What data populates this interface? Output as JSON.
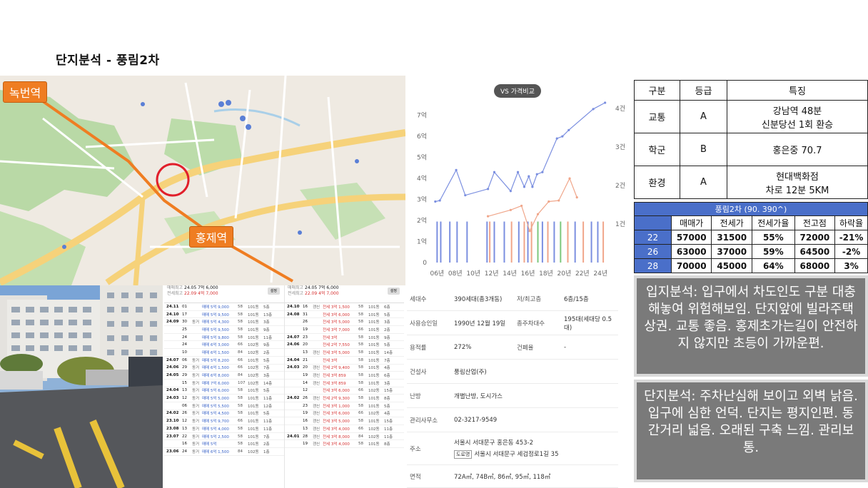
{
  "title": "단지분석 -  풍림2차",
  "map": {
    "station_1": "녹번역",
    "station_2": "홍제역"
  },
  "transactions": {
    "left": {
      "header_line1": "24.05  7억 6,000",
      "header_line2": "22.09  4억 7,000",
      "header_label1": "매매최고",
      "header_label2": "전세최고",
      "button": "설정",
      "rows": [
        {
          "date": "24.11",
          "day": "01",
          "type": "",
          "price": "매매 5억 9,000",
          "size": "58",
          "bldg": "101동",
          "floor": "5층"
        },
        {
          "date": "24.10",
          "day": "17",
          "type": "",
          "price": "매매 5억 9,500",
          "size": "58",
          "bldg": "101동",
          "floor": "13층"
        },
        {
          "date": "24.09",
          "day": "30",
          "type": "동거",
          "price": "매매 5억 4,300",
          "size": "58",
          "bldg": "101동",
          "floor": "3층"
        },
        {
          "date": "",
          "day": "25",
          "type": "",
          "price": "매매 5억 9,500",
          "size": "58",
          "bldg": "101동",
          "floor": "9층"
        },
        {
          "date": "",
          "day": "24",
          "type": "",
          "price": "매매 5억 9,800",
          "size": "58",
          "bldg": "101동",
          "floor": "11층"
        },
        {
          "date": "",
          "day": "24",
          "type": "",
          "price": "매매 6억 3,000",
          "size": "66",
          "bldg": "102동",
          "floor": "9층"
        },
        {
          "date": "",
          "day": "10",
          "type": "",
          "price": "매매 6억 1,500",
          "size": "84",
          "bldg": "102동",
          "floor": "2층"
        },
        {
          "date": "24.07",
          "day": "06",
          "type": "동거",
          "price": "매매 5억 8,200",
          "size": "66",
          "bldg": "101동",
          "floor": "5층"
        },
        {
          "date": "24.06",
          "day": "29",
          "type": "동거",
          "price": "매매 6억 1,500",
          "size": "66",
          "bldg": "102동",
          "floor": "7층"
        },
        {
          "date": "24.05",
          "day": "29",
          "type": "동거",
          "price": "매매 6억 8,000",
          "size": "84",
          "bldg": "102동",
          "floor": "3층"
        },
        {
          "date": "",
          "day": "15",
          "type": "동거",
          "price": "매매 7억 6,000",
          "size": "107",
          "bldg": "102동",
          "floor": "14층"
        },
        {
          "date": "24.04",
          "day": "13",
          "type": "동거",
          "price": "매매 5억 6,000",
          "size": "58",
          "bldg": "101동",
          "floor": "5층"
        },
        {
          "date": "24.03",
          "day": "12",
          "type": "동거",
          "price": "매매 5억 5,000",
          "size": "58",
          "bldg": "101동",
          "floor": "11층"
        },
        {
          "date": "",
          "day": "06",
          "type": "동거",
          "price": "매매 5억 5,500",
          "size": "58",
          "bldg": "101동",
          "floor": "12층"
        },
        {
          "date": "24.02",
          "day": "26",
          "type": "동거",
          "price": "매매 5억 4,500",
          "size": "58",
          "bldg": "101동",
          "floor": "5층"
        },
        {
          "date": "23.10",
          "day": "12",
          "type": "동거",
          "price": "매매 5억 9,700",
          "size": "66",
          "bldg": "101동",
          "floor": "11층"
        },
        {
          "date": "23.08",
          "day": "13",
          "type": "동거",
          "price": "매매 5억 4,000",
          "size": "58",
          "bldg": "101동",
          "floor": "11층"
        },
        {
          "date": "23.07",
          "day": "22",
          "type": "동거",
          "price": "매매 5억 2,500",
          "size": "58",
          "bldg": "101동",
          "floor": "7층"
        },
        {
          "date": "",
          "day": "16",
          "type": "동거",
          "price": "매매 5억",
          "size": "58",
          "bldg": "101동",
          "floor": "2층"
        },
        {
          "date": "23.06",
          "day": "24",
          "type": "동거",
          "price": "매매 6억 1,500",
          "size": "84",
          "bldg": "102동",
          "floor": "1층"
        }
      ]
    },
    "right": {
      "header_line1": "24.05  7억 6,000",
      "header_line2": "22.09  4억 7,000",
      "header_label1": "매매최고",
      "header_label2": "전세최고",
      "button": "설정",
      "rows": [
        {
          "date": "24.10",
          "day": "16",
          "type": "갱신",
          "price": "전세 3억 1,500",
          "size": "58",
          "bldg": "101동",
          "floor": "6층"
        },
        {
          "date": "24.08",
          "day": "31",
          "type": "",
          "price": "전세 3억 6,000",
          "size": "58",
          "bldg": "101동",
          "floor": "5층"
        },
        {
          "date": "",
          "day": "26",
          "type": "",
          "price": "전세 3억 5,000",
          "size": "58",
          "bldg": "101동",
          "floor": "3층"
        },
        {
          "date": "",
          "day": "19",
          "type": "",
          "price": "전세 3억 7,000",
          "size": "66",
          "bldg": "101동",
          "floor": "2층"
        },
        {
          "date": "24.07",
          "day": "23",
          "type": "",
          "price": "전세 3억",
          "size": "58",
          "bldg": "101동",
          "floor": "9층"
        },
        {
          "date": "24.06",
          "day": "20",
          "type": "",
          "price": "전세 2억 7,550",
          "size": "58",
          "bldg": "101동",
          "floor": "5층"
        },
        {
          "date": "",
          "day": "13",
          "type": "갱신",
          "price": "전세 3억 5,000",
          "size": "58",
          "bldg": "101동",
          "floor": "14층"
        },
        {
          "date": "24.04",
          "day": "21",
          "type": "",
          "price": "전세 3억",
          "size": "58",
          "bldg": "101동",
          "floor": "7층"
        },
        {
          "date": "24.03",
          "day": "20",
          "type": "갱신",
          "price": "전세 2억 9,400",
          "size": "58",
          "bldg": "101동",
          "floor": "4층"
        },
        {
          "date": "",
          "day": "19",
          "type": "갱신",
          "price": "전세 3억 859",
          "size": "58",
          "bldg": "101동",
          "floor": "6층"
        },
        {
          "date": "",
          "day": "14",
          "type": "갱신",
          "price": "전세 3억 859",
          "size": "58",
          "bldg": "101동",
          "floor": "3층"
        },
        {
          "date": "",
          "day": "12",
          "type": "",
          "price": "전세 3억 6,000",
          "size": "66",
          "bldg": "102동",
          "floor": "15층"
        },
        {
          "date": "24.02",
          "day": "26",
          "type": "갱신",
          "price": "전세 2억 9,300",
          "size": "58",
          "bldg": "101동",
          "floor": "8층"
        },
        {
          "date": "",
          "day": "23",
          "type": "갱신",
          "price": "전세 3억 1,000",
          "size": "58",
          "bldg": "101동",
          "floor": "5층"
        },
        {
          "date": "",
          "day": "19",
          "type": "갱신",
          "price": "전세 3억 6,000",
          "size": "66",
          "bldg": "102동",
          "floor": "4층"
        },
        {
          "date": "",
          "day": "16",
          "type": "갱신",
          "price": "전세 3억 5,000",
          "size": "58",
          "bldg": "101동",
          "floor": "15층"
        },
        {
          "date": "",
          "day": "13",
          "type": "갱신",
          "price": "전세 3억 4,000",
          "size": "66",
          "bldg": "102동",
          "floor": "11층"
        },
        {
          "date": "24.01",
          "day": "28",
          "type": "갱신",
          "price": "전세 3억 8,000",
          "size": "84",
          "bldg": "102동",
          "floor": "11층"
        },
        {
          "date": "",
          "day": "19",
          "type": "갱신",
          "price": "전세 3억 4,000",
          "size": "58",
          "bldg": "101동",
          "floor": "8층"
        }
      ]
    }
  },
  "chart_data": {
    "type": "line",
    "title": "VS 가격비교",
    "y_left_ticks": [
      "0",
      "1억",
      "2억",
      "3억",
      "4억",
      "5억",
      "6억",
      "7억"
    ],
    "y_right_ticks": [
      "1건",
      "2건",
      "3건",
      "4건"
    ],
    "x_ticks": [
      "06년",
      "08년",
      "10년",
      "12년",
      "14년",
      "16년",
      "18년",
      "20년",
      "22년",
      "24년"
    ],
    "xlim": [
      2005.5,
      2025
    ],
    "ylim": [
      0,
      7.6
    ],
    "series": [
      {
        "color": "#7b8fe0",
        "points": [
          [
            2005.8,
            2.9
          ],
          [
            2006.3,
            2.95
          ],
          [
            2008.1,
            4.4
          ],
          [
            2009.1,
            3.2
          ],
          [
            2011.6,
            3.5
          ],
          [
            2012.3,
            4.3
          ],
          [
            2014.1,
            3.4
          ],
          [
            2014.9,
            4.3
          ],
          [
            2015.6,
            3.6
          ],
          [
            2016.1,
            4.1
          ],
          [
            2016.5,
            3.6
          ],
          [
            2017.0,
            4.2
          ],
          [
            2017.6,
            4.3
          ],
          [
            2019.2,
            5.9
          ],
          [
            2019.8,
            6.0
          ],
          [
            2020.5,
            6.3
          ],
          [
            2023.2,
            7.3
          ],
          [
            2024.5,
            7.6
          ]
        ],
        "unit": "억"
      },
      {
        "color": "#f0a68a",
        "points": [
          [
            2011.6,
            2.2
          ],
          [
            2014.1,
            2.5
          ],
          [
            2015.3,
            2.7
          ],
          [
            2016.2,
            1.5
          ],
          [
            2017.1,
            2.3
          ],
          [
            2018.3,
            2.9
          ],
          [
            2019.4,
            2.95
          ],
          [
            2020.6,
            4.0
          ],
          [
            2021.4,
            3.1
          ]
        ],
        "unit": "억"
      }
    ],
    "volume_bars": [
      {
        "x": 2006.0,
        "color": "#7b8fe0"
      },
      {
        "x": 2006.4,
        "color": "#7b8fe0"
      },
      {
        "x": 2007.4,
        "color": "#7b8fe0"
      },
      {
        "x": 2008.2,
        "color": "#7b8fe0"
      },
      {
        "x": 2009.3,
        "color": "#7b8fe0"
      },
      {
        "x": 2011.5,
        "color": "#7b8fe0"
      },
      {
        "x": 2011.8,
        "color": "#f0a68a"
      },
      {
        "x": 2012.3,
        "color": "#7b8fe0"
      },
      {
        "x": 2013.4,
        "color": "#7b8fe0"
      },
      {
        "x": 2014.2,
        "color": "#f0a68a"
      },
      {
        "x": 2015.0,
        "color": "#7b8fe0"
      },
      {
        "x": 2015.6,
        "color": "#f0a68a"
      },
      {
        "x": 2016.0,
        "color": "#7b8fe0"
      },
      {
        "x": 2016.4,
        "color": "#f0a68a"
      },
      {
        "x": 2017.1,
        "color": "#7dc87d"
      },
      {
        "x": 2017.6,
        "color": "#7b8fe0"
      },
      {
        "x": 2018.2,
        "color": "#f0a68a"
      },
      {
        "x": 2018.9,
        "color": "#7b8fe0"
      },
      {
        "x": 2019.6,
        "color": "#7dc87d"
      },
      {
        "x": 2020.4,
        "color": "#f0a68a"
      },
      {
        "x": 2021.2,
        "color": "#7b8fe0"
      },
      {
        "x": 2022.1,
        "color": "#f0a68a"
      },
      {
        "x": 2023.0,
        "color": "#7b8fe0"
      },
      {
        "x": 2023.7,
        "color": "#7b8fe0"
      },
      {
        "x": 2024.3,
        "color": "#f0a68a"
      }
    ]
  },
  "complex_info": [
    {
      "k": "세대수",
      "v": "390세대(총3개동)",
      "k2": "저/최고층",
      "v2": "6층/15층"
    },
    {
      "k": "사용승인일",
      "v": "1990년 12월 19일",
      "k2": "총주차대수",
      "v2": "195대(세대당 0.5대)"
    },
    {
      "k": "용적률",
      "v": "272%",
      "k2": "건폐율",
      "v2": "-"
    },
    {
      "k": "건설사",
      "v": "풍림산업(주)",
      "k2": "",
      "v2": ""
    },
    {
      "k": "난방",
      "v": "개별난방, 도시가스",
      "k2": "",
      "v2": ""
    },
    {
      "k": "관리사무소",
      "v": "02-3217-9549",
      "k2": "",
      "v2": ""
    },
    {
      "k": "주소",
      "v": "서울시 서대문구 홍은동 453-2",
      "road_tag": "도로명",
      "v_extra": "서울시 서대문구 세검정로1길 35",
      "k2": "",
      "v2": ""
    },
    {
      "k": "면적",
      "v": "72A㎡, 74B㎡, 86㎡, 95㎡, 118㎡",
      "k2": "",
      "v2": ""
    }
  ],
  "grade_table": {
    "headers": [
      "구분",
      "등급",
      "특징"
    ],
    "rows": [
      {
        "cat": "교통",
        "grade": "A",
        "feature": [
          "강남역 48분",
          "신분당선 1회 환승"
        ]
      },
      {
        "cat": "학군",
        "grade": "B",
        "feature": [
          "홍은중 70.7"
        ]
      },
      {
        "cat": "환경",
        "grade": "A",
        "feature": [
          "현대백화점",
          "차로 12분 5KM"
        ]
      }
    ]
  },
  "price_table": {
    "title": "풍림2차 (90. 390^)",
    "headers": [
      "",
      "매매가",
      "전세가",
      "전세가율",
      "전고점",
      "하락율"
    ],
    "rows": [
      [
        "22",
        "57000",
        "31500",
        "55%",
        "72000",
        "-21%"
      ],
      [
        "26",
        "63000",
        "37000",
        "59%",
        "64500",
        "-2%"
      ],
      [
        "28",
        "70000",
        "45000",
        "64%",
        "68000",
        "3%"
      ]
    ]
  },
  "notes": {
    "location": "입지분석: 입구에서 차도인도 구분 대충해놓여 위험해보임. 단지앞에 빌라주택상권. 교통 좋음. 홍제초가는길이 안전하지 않지만 초등이 가까운편.",
    "complex": "단지분석: 주차난심해 보이고 외벽 낡음. 입구에 심한 언덕. 단지는 평지인편. 동간거리 넓음. 오래된 구축 느낌. 관리보통."
  }
}
